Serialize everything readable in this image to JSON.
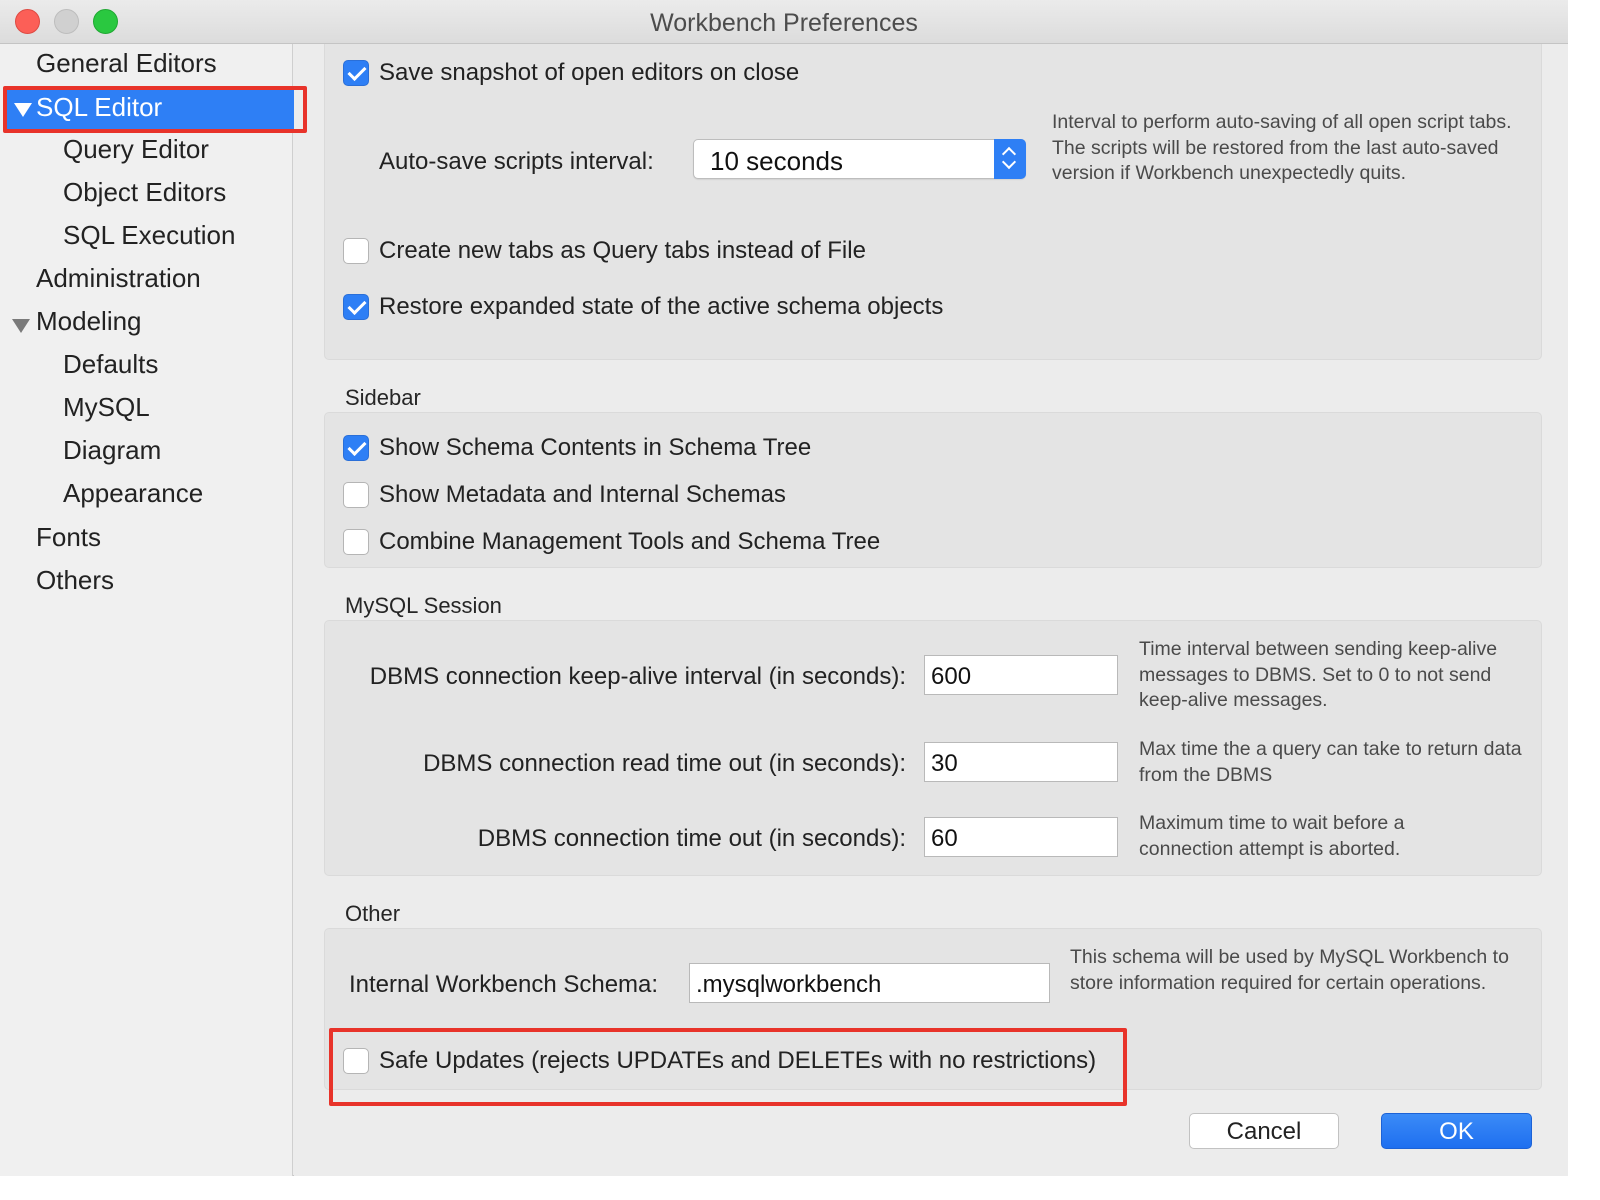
{
  "window": {
    "title": "Workbench Preferences"
  },
  "sidebar": {
    "items": [
      {
        "label": "General Editors"
      },
      {
        "label": "SQL Editor",
        "selected": true,
        "expanded": true
      },
      {
        "label": "Query Editor"
      },
      {
        "label": "Object Editors"
      },
      {
        "label": "SQL Execution"
      },
      {
        "label": "Administration"
      },
      {
        "label": "Modeling",
        "expanded": true
      },
      {
        "label": "Defaults"
      },
      {
        "label": "MySQL"
      },
      {
        "label": "Diagram"
      },
      {
        "label": "Appearance"
      },
      {
        "label": "Fonts"
      },
      {
        "label": "Others"
      }
    ]
  },
  "general": {
    "save_snapshot": {
      "label": "Save snapshot of open editors on close",
      "checked": true
    },
    "autosave": {
      "label": "Auto-save scripts interval:",
      "value": "10 seconds",
      "description": "Interval to perform auto-saving of all open script tabs. The scripts will be restored from the last auto-saved version if Workbench unexpectedly quits."
    },
    "new_tabs_query": {
      "label": "Create new tabs as Query tabs instead of File",
      "checked": false
    },
    "restore_expanded": {
      "label": "Restore expanded state of the active schema objects",
      "checked": true
    }
  },
  "sidebar_section": {
    "title": "Sidebar",
    "show_schema_contents": {
      "label": "Show Schema Contents in Schema Tree",
      "checked": true
    },
    "show_metadata": {
      "label": "Show Metadata and Internal Schemas",
      "checked": false
    },
    "combine_tools": {
      "label": "Combine Management Tools and Schema Tree",
      "checked": false
    }
  },
  "session": {
    "title": "MySQL Session",
    "keepalive": {
      "label": "DBMS connection keep-alive interval (in seconds):",
      "value": "600",
      "description": "Time interval between sending keep-alive messages to DBMS. Set to 0 to not send keep-alive messages."
    },
    "read_timeout": {
      "label": "DBMS connection read time out (in seconds):",
      "value": "30",
      "description": "Max time the a query can take to return data from the DBMS"
    },
    "conn_timeout": {
      "label": "DBMS connection time out (in seconds):",
      "value": "60",
      "description": "Maximum time to wait before a connection attempt is aborted."
    }
  },
  "other": {
    "title": "Other",
    "schema": {
      "label": "Internal Workbench Schema:",
      "value": ".mysqlworkbench",
      "description": "This schema will be used by MySQL Workbench to store information required for certain operations."
    },
    "safe_updates": {
      "label": "Safe Updates (rejects UPDATEs and DELETEs with no restrictions)",
      "checked": false
    }
  },
  "buttons": {
    "cancel": "Cancel",
    "ok": "OK"
  },
  "colors": {
    "accent": "#2e7ff5",
    "highlight_box": "#e8332a"
  }
}
